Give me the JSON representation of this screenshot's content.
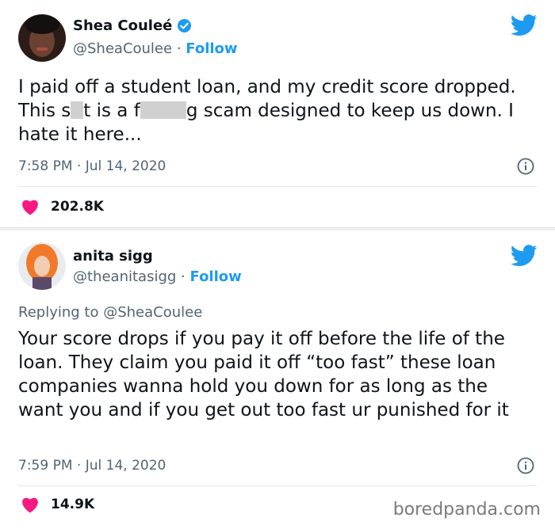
{
  "tweets": [
    {
      "author": {
        "name": "Shea Couleé",
        "handle": "@SheaCoulee",
        "follow_label": "Follow",
        "verified": true
      },
      "text_part1": "I paid off a student loan, and my credit score dropped. This s",
      "text_part2": "t is a f",
      "text_part3": "g scam designed to keep us down. I hate it here...",
      "timestamp": "7:58 PM · Jul 14, 2020",
      "likes": "202.8K"
    },
    {
      "author": {
        "name": "anita sigg",
        "handle": "@theanitasigg",
        "follow_label": "Follow",
        "verified": false
      },
      "replying_prefix": "Replying to",
      "replying_to": "@SheaCoulee",
      "text": "Your score drops if you pay it off before the life of the loan. They claim you paid it off “too fast” these loan companies wanna hold you down for as long as the want you and if you get out too fast ur punished for it",
      "timestamp": "7:59 PM · Jul 14, 2020",
      "likes": "14.9K"
    }
  ],
  "icons": {
    "bird": "twitter-bird-icon",
    "info": "info-icon",
    "heart": "heart-icon",
    "verified": "verified-badge-icon"
  },
  "colors": {
    "accent": "#1d9bf0",
    "heart": "#f91880",
    "muted": "#536471"
  },
  "watermark": "boredpanda.com"
}
